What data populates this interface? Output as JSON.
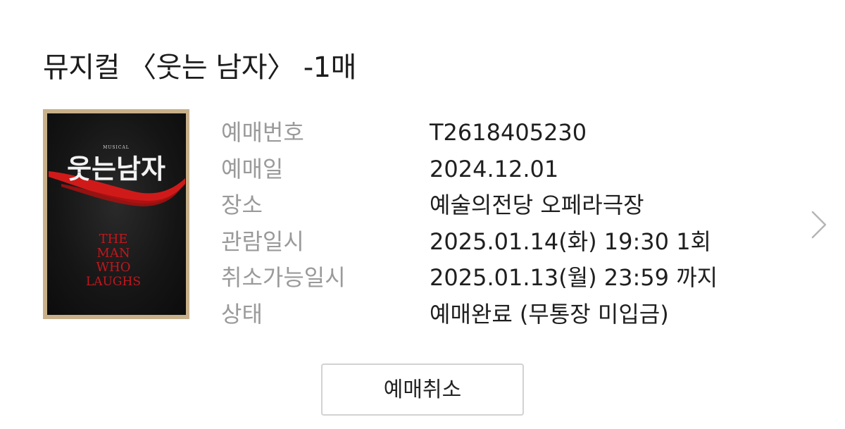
{
  "ticket": {
    "title": "뮤지컬 〈웃는 남자〉 -1매",
    "poster": {
      "title_ko": "웃는남자",
      "small_caption": "MUSICAL",
      "title_en_lines": [
        "THE",
        "MAN",
        "WHO",
        "LAUGHS"
      ]
    },
    "details": [
      {
        "label": "예매번호",
        "value": "T2618405230"
      },
      {
        "label": "예매일",
        "value": "2024.12.01"
      },
      {
        "label": "장소",
        "value": "예술의전당 오페라극장"
      },
      {
        "label": "관람일시",
        "value": "2025.01.14(화) 19:30 1회"
      },
      {
        "label": "취소가능일시",
        "value": "2025.01.13(월) 23:59 까지"
      },
      {
        "label": "상태",
        "value": "예매완료 (무통장 미입금)"
      }
    ],
    "cancel_button_label": "예매취소",
    "chevron_icon": "chevron-right-icon"
  },
  "colors": {
    "label": "#9a9a9a",
    "value": "#1f1f1f",
    "poster_red": "#d01a1a",
    "button_border": "#d2d2d2"
  }
}
